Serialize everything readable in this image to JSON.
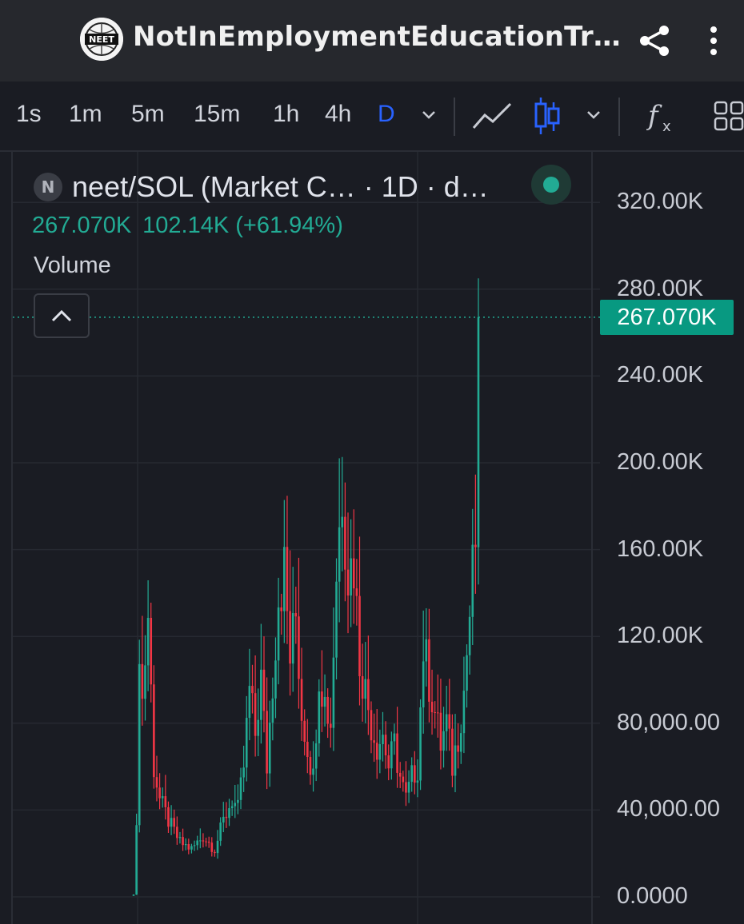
{
  "appbar": {
    "title": "NotInEmploymentEducationTrai…",
    "logo_icon": "neet-logo-icon",
    "share_icon": "share-icon",
    "more_icon": "more-vertical-icon"
  },
  "toolbar": {
    "timeframes": [
      "1s",
      "1m",
      "5m",
      "15m",
      "1h",
      "4h",
      "D"
    ],
    "active_timeframe": "D",
    "icons": [
      "chevron-down-icon",
      "line-chart-icon",
      "candlestick-icon",
      "chevron-down-icon",
      "indicators-icon",
      "layout-grid-icon"
    ]
  },
  "legend": {
    "symbol_badge": "N",
    "symbol": "neet/SOL (Market C… · 1D · d…",
    "last_value": "267.070K",
    "change": "102.14K (+61.94%)",
    "indicator_label": "Volume"
  },
  "price_scale": {
    "current_price_label": "267.070K",
    "ticks": [
      "320.00K",
      "280.00K",
      "240.00K",
      "200.00K",
      "160.00K",
      "120.00K",
      "80,000.00",
      "40,000.00",
      "0.0000"
    ]
  },
  "colors": {
    "up": "#22ab94",
    "down": "#f23645",
    "active_timeframe": "#2962ff",
    "price_tag": "#089981",
    "background": "#1a1c23"
  },
  "chart_data": {
    "type": "candlestick",
    "title": "neet/SOL (Market C… · 1D · d…",
    "interval": "1D",
    "ylim": [
      0,
      320000
    ],
    "last_close": 267070,
    "change_abs": 102140,
    "change_pct": 61.94,
    "grid": true,
    "anchors": [
      {
        "i": 0,
        "close": 1000
      },
      {
        "i": 1,
        "close": 30000
      },
      {
        "i": 2,
        "close": 120000
      },
      {
        "i": 3,
        "close": 90000
      },
      {
        "i": 5,
        "close": 130000
      },
      {
        "i": 7,
        "close": 60000
      },
      {
        "i": 9,
        "close": 45000
      },
      {
        "i": 12,
        "close": 35000
      },
      {
        "i": 16,
        "close": 25000
      },
      {
        "i": 20,
        "close": 22000
      },
      {
        "i": 24,
        "close": 28000
      },
      {
        "i": 28,
        "close": 22000
      },
      {
        "i": 31,
        "close": 35000
      },
      {
        "i": 34,
        "close": 45000
      },
      {
        "i": 36,
        "close": 40000
      },
      {
        "i": 38,
        "close": 60000
      },
      {
        "i": 40,
        "close": 95000
      },
      {
        "i": 42,
        "close": 75000
      },
      {
        "i": 44,
        "close": 100000
      },
      {
        "i": 46,
        "close": 60000
      },
      {
        "i": 48,
        "close": 100000
      },
      {
        "i": 50,
        "close": 140000
      },
      {
        "i": 52,
        "close": 150000
      },
      {
        "i": 54,
        "close": 110000
      },
      {
        "i": 56,
        "close": 130000
      },
      {
        "i": 58,
        "close": 85000
      },
      {
        "i": 60,
        "close": 70000
      },
      {
        "i": 62,
        "close": 55000
      },
      {
        "i": 64,
        "close": 105000
      },
      {
        "i": 66,
        "close": 90000
      },
      {
        "i": 68,
        "close": 80000
      },
      {
        "i": 70,
        "close": 150000
      },
      {
        "i": 72,
        "close": 190000
      },
      {
        "i": 74,
        "close": 150000
      },
      {
        "i": 76,
        "close": 155000
      },
      {
        "i": 78,
        "close": 110000
      },
      {
        "i": 80,
        "close": 95000
      },
      {
        "i": 82,
        "close": 80000
      },
      {
        "i": 84,
        "close": 70000
      },
      {
        "i": 86,
        "close": 75000
      },
      {
        "i": 88,
        "close": 60000
      },
      {
        "i": 90,
        "close": 70000
      },
      {
        "i": 92,
        "close": 55000
      },
      {
        "i": 94,
        "close": 45000
      },
      {
        "i": 96,
        "close": 55000
      },
      {
        "i": 98,
        "close": 60000
      },
      {
        "i": 100,
        "close": 115000
      },
      {
        "i": 102,
        "close": 100000
      },
      {
        "i": 104,
        "close": 85000
      },
      {
        "i": 106,
        "close": 70000
      },
      {
        "i": 108,
        "close": 80000
      },
      {
        "i": 110,
        "close": 60000
      },
      {
        "i": 112,
        "close": 75000
      },
      {
        "i": 114,
        "close": 95000
      },
      {
        "i": 116,
        "close": 130000
      },
      {
        "i": 118,
        "close": 165000
      },
      {
        "i": 119,
        "close": 267070
      }
    ]
  }
}
